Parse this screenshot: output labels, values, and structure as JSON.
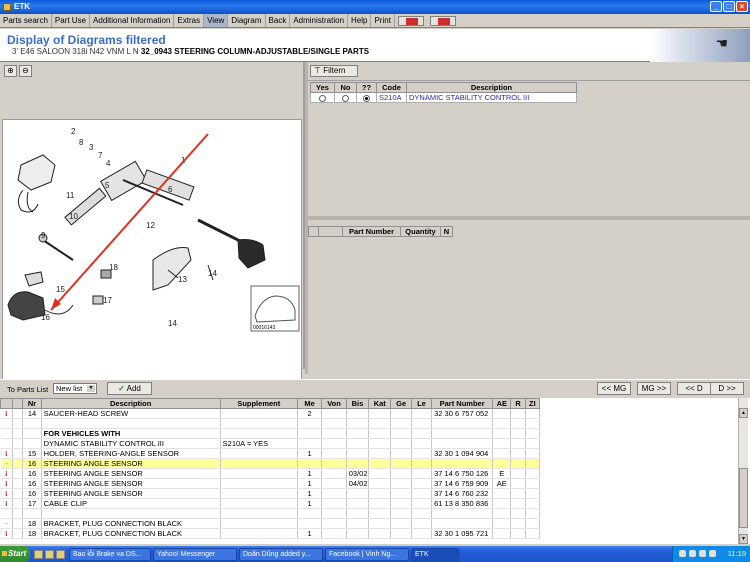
{
  "window": {
    "title": "ETK"
  },
  "menu": [
    "Parts search",
    "Part Use",
    "Additional Information",
    "Extras",
    "View",
    "Diagram",
    "Back",
    "Administration",
    "Help",
    "Print"
  ],
  "header": {
    "title": "Display of Diagrams filtered",
    "vehicle": "3' E46 SALOON 318i N42 VNM  L N",
    "diagram": "32_0943 STEERING COLUMN-ADJUSTABLE/SINGLE PARTS"
  },
  "diagram": {
    "callouts": [
      "2",
      "8",
      "3",
      "7",
      "4",
      "5",
      "1",
      "6",
      "11",
      "12",
      "10",
      "9",
      "13",
      "15",
      "18",
      "17",
      "16",
      "14",
      "14"
    ],
    "image_code": "00016143"
  },
  "filter": {
    "button": "Filtern",
    "columns": [
      "Yes",
      "No",
      "??",
      "Code",
      "Description"
    ],
    "rows": [
      {
        "yes": false,
        "no": false,
        "unknown": true,
        "code": "S210A",
        "description": "DYNAMIC STABILITY CONTROL III"
      }
    ]
  },
  "parts_columns": [
    "Part Number",
    "Quantity",
    "N"
  ],
  "toolbar": {
    "to_parts_list": "To Parts List",
    "list_select": "New list",
    "add": "Add",
    "nav": [
      "<< MG",
      "MG >>",
      "<< D",
      "D >>"
    ]
  },
  "list": {
    "columns": [
      "Nr",
      "Description",
      "Supplement",
      "Me",
      "Von",
      "Bis",
      "Kat",
      "Ge",
      "Le",
      "Part Number",
      "AE",
      "R",
      "ZI"
    ],
    "rows": [
      {
        "icon": "i",
        "nr": "14",
        "desc": "SAUCER-HEAD SCREW",
        "supp": "",
        "me": "2",
        "von": "",
        "bis": "",
        "pn": "32 30 6 757 052",
        "ae": "",
        "hl": false
      },
      {
        "icon": "",
        "nr": "",
        "desc": "",
        "supp": "",
        "me": "",
        "von": "",
        "bis": "",
        "pn": "",
        "ae": "",
        "hl": false
      },
      {
        "icon": "",
        "nr": "",
        "desc": "FOR VEHICLES WITH",
        "supp": "",
        "me": "",
        "von": "",
        "bis": "",
        "pn": "",
        "ae": "",
        "hl": false,
        "bold": true
      },
      {
        "icon": "",
        "nr": "",
        "desc": "DYNAMIC STABILITY CONTROL III",
        "supp": "S210A = YES",
        "me": "",
        "von": "",
        "bis": "",
        "pn": "",
        "ae": "",
        "hl": false
      },
      {
        "icon": "i",
        "nr": "15",
        "desc": "HOLDER, STEERING-ANGLE SENSOR",
        "supp": "",
        "me": "1",
        "von": "",
        "bis": "",
        "pn": "32 30 1 094 904",
        "ae": "",
        "hl": false
      },
      {
        "icon": "-",
        "nr": "16",
        "desc": "STEERING ANGLE SENSOR",
        "supp": "",
        "me": "",
        "von": "",
        "bis": "",
        "pn": "",
        "ae": "",
        "hl": true
      },
      {
        "icon": "i",
        "nr": "16",
        "desc": "STEERING ANGLE SENSOR",
        "supp": "",
        "me": "1",
        "von": "",
        "bis": "03/02",
        "pn": "37 14 6 750 126",
        "ae": "E",
        "hl": false
      },
      {
        "icon": "i",
        "nr": "16",
        "desc": "STEERING ANGLE SENSOR",
        "supp": "",
        "me": "1",
        "von": "",
        "bis": "04/02",
        "pn": "37 14 6 759 909",
        "ae": "AE",
        "hl": false
      },
      {
        "icon": "i",
        "nr": "16",
        "desc": "STEERING ANGLE SENSOR",
        "supp": "",
        "me": "1",
        "von": "",
        "bis": "",
        "pn": "37 14 6 760 232",
        "ae": "",
        "hl": false
      },
      {
        "icon": "i",
        "nr": "17",
        "desc": "CABLE CLIP",
        "supp": "",
        "me": "1",
        "von": "",
        "bis": "",
        "pn": "61 13 8 350 836",
        "ae": "",
        "hl": false
      },
      {
        "icon": "",
        "nr": "",
        "desc": "",
        "supp": "",
        "me": "",
        "von": "",
        "bis": "",
        "pn": "",
        "ae": "",
        "hl": false
      },
      {
        "icon": "-",
        "nr": "18",
        "desc": "BRACKET, PLUG CONNECTION BLACK",
        "supp": "",
        "me": "",
        "von": "",
        "bis": "",
        "pn": "",
        "ae": "",
        "hl": false
      },
      {
        "icon": "i",
        "nr": "18",
        "desc": "BRACKET, PLUG CONNECTION BLACK",
        "supp": "",
        "me": "1",
        "von": "",
        "bis": "",
        "pn": "32 30 1 095 721",
        "ae": "",
        "hl": false
      }
    ]
  },
  "taskbar": {
    "start": "Start",
    "tasks": [
      "Bao lỗi Brake va DS...",
      "Yahoo! Messenger",
      "Doãn Dũng added y...",
      "Facebook | Vinh Ng...",
      "ETK"
    ],
    "clock": "11:19"
  },
  "colors": {
    "title_blue": "#3a6ec8",
    "highlight_row": "#ffff9c",
    "arrow_red": "#e03020",
    "info_icon": "#cc2020"
  }
}
